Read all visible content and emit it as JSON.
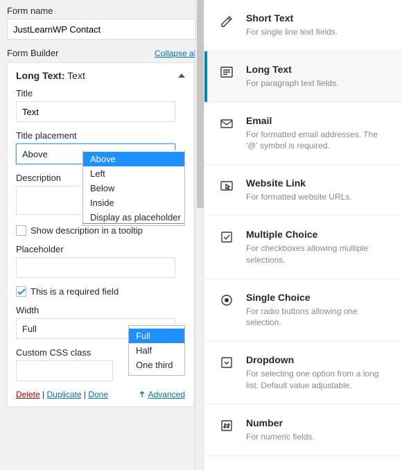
{
  "form_name_label": "Form name",
  "form_name_value": "JustLearnWP Contact",
  "form_builder_label": "Form Builder",
  "collapse_all": "Collapse all",
  "block": {
    "type_label": "Long Text:",
    "type_suffix": " Text",
    "title_label": "Title",
    "title_value": "Text",
    "placement_label": "Title placement",
    "placement_value": "Above",
    "placement_options": [
      "Above",
      "Left",
      "Below",
      "Inside",
      "Display as placeholder"
    ],
    "description_label": "Description",
    "show_tooltip": "Show description in a tooltip",
    "placeholder_label": "Placeholder",
    "required_label": "This is a required field",
    "width_label": "Width",
    "width_value": "Full",
    "width_options": [
      "Full",
      "Half",
      "One third"
    ],
    "css_label": "Custom CSS class",
    "delete": "Delete",
    "duplicate": "Duplicate",
    "done": "Done",
    "advanced": "Advanced"
  },
  "field_types": [
    {
      "title": "Short Text",
      "desc": "For single line text fields.",
      "icon": "pen"
    },
    {
      "title": "Long Text",
      "desc": "For paragraph text fields.",
      "icon": "paragraph",
      "active": true
    },
    {
      "title": "Email",
      "desc": "For formatted email addresses. The '@' symbol is required.",
      "icon": "mail"
    },
    {
      "title": "Website Link",
      "desc": "For formatted website URLs.",
      "icon": "cursor"
    },
    {
      "title": "Multiple Choice",
      "desc": "For checkboxes allowing multiple selections.",
      "icon": "checkbox"
    },
    {
      "title": "Single Choice",
      "desc": "For radio buttons allowing one selection.",
      "icon": "radio"
    },
    {
      "title": "Dropdown",
      "desc": "For selecting one option from a long list. Default value adjustable.",
      "icon": "dropdown"
    },
    {
      "title": "Number",
      "desc": "For numeric fields.",
      "icon": "hash"
    }
  ]
}
